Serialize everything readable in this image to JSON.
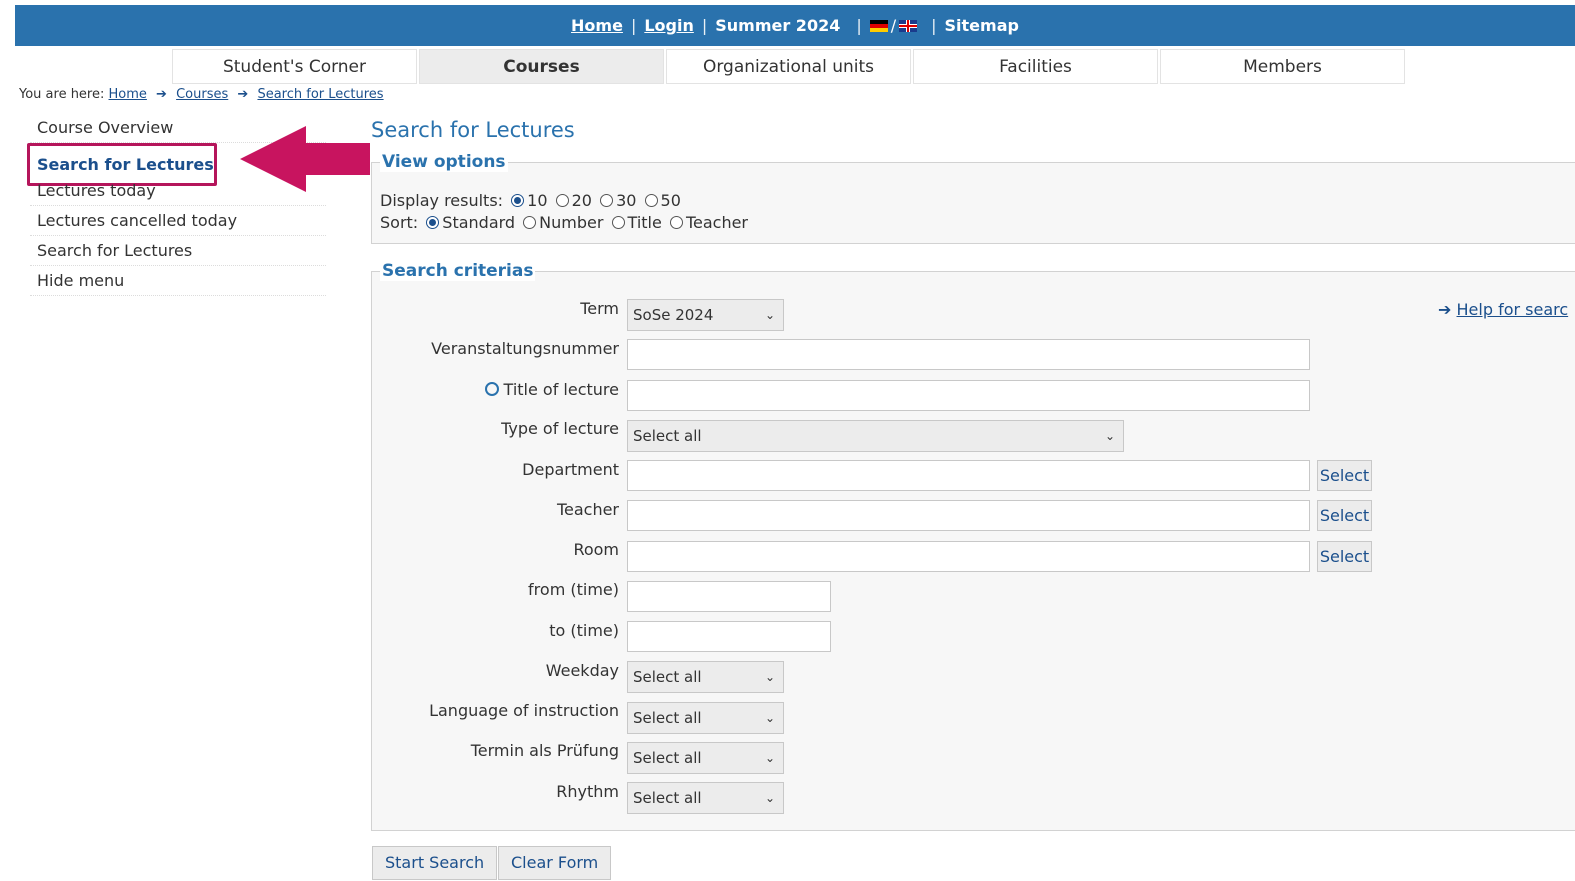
{
  "topbar": {
    "home": "Home",
    "login": "Login",
    "semester": "Summer 2024",
    "lang_sep": "/",
    "sitemap": "Sitemap"
  },
  "tabs": [
    {
      "label": "Student's Corner"
    },
    {
      "label": "Courses"
    },
    {
      "label": "Organizational units"
    },
    {
      "label": "Facilities"
    },
    {
      "label": "Members"
    }
  ],
  "breadcrumb": {
    "prefix": "You are here:",
    "items": [
      "Home",
      "Courses",
      "Search for Lectures"
    ]
  },
  "sidebar": {
    "items": [
      {
        "label": "Course Overview"
      },
      {
        "label": "Search for Lectures"
      },
      {
        "label": "Lectures today"
      },
      {
        "label": "Lectures cancelled today"
      },
      {
        "label": "Search for Lectures"
      },
      {
        "label": "Hide menu"
      }
    ]
  },
  "page": {
    "title": "Search for Lectures"
  },
  "view_options": {
    "legend": "View options",
    "display_label": "Display results:",
    "display_options": [
      "10",
      "20",
      "30",
      "50"
    ],
    "display_selected": "10",
    "sort_label": "Sort:",
    "sort_options": [
      "Standard",
      "Number",
      "Title",
      "Teacher"
    ],
    "sort_selected": "Standard"
  },
  "criteria": {
    "legend": "Search criterias",
    "help_link": "Help for searc",
    "term": {
      "label": "Term",
      "value": "SoSe 2024"
    },
    "number": {
      "label": "Veranstaltungsnummer",
      "value": ""
    },
    "title": {
      "label": "Title of lecture",
      "value": ""
    },
    "type": {
      "label": "Type of lecture",
      "value": "Select all"
    },
    "department": {
      "label": "Department",
      "value": ""
    },
    "teacher": {
      "label": "Teacher",
      "value": ""
    },
    "room": {
      "label": "Room",
      "value": ""
    },
    "from_time": {
      "label": "from (time)",
      "value": ""
    },
    "to_time": {
      "label": "to (time)",
      "value": ""
    },
    "weekday": {
      "label": "Weekday",
      "value": "Select all"
    },
    "language": {
      "label": "Language of instruction",
      "value": "Select all"
    },
    "exam": {
      "label": "Termin als Prüfung",
      "value": "Select all"
    },
    "rhythm": {
      "label": "Rhythm",
      "value": "Select all"
    },
    "select_button": "Select"
  },
  "actions": {
    "start": "Start Search",
    "clear": "Clear Form"
  },
  "colors": {
    "header": "#2a72ad",
    "highlight": "#b5155b",
    "link": "#1b4f8c"
  }
}
